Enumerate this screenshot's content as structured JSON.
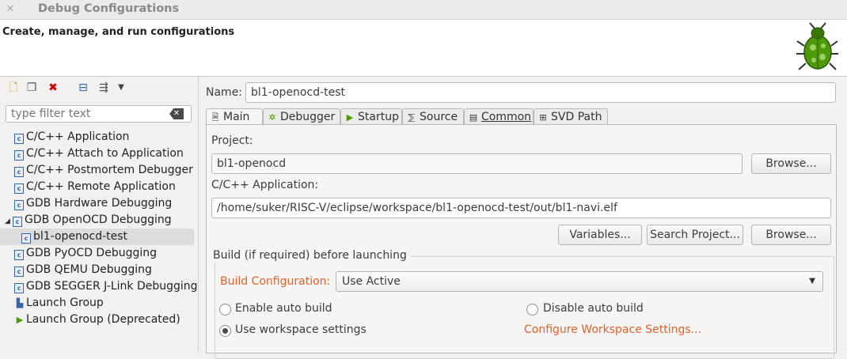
{
  "window": {
    "title": "Debug Configurations"
  },
  "header": {
    "message": "Create, manage, and run configurations"
  },
  "toolbar": {
    "icons": [
      "new-config-icon",
      "duplicate-icon",
      "delete-icon",
      "collapse-all-icon",
      "filter-icon",
      "view-menu-icon"
    ]
  },
  "filter": {
    "placeholder": "type filter text"
  },
  "tree": {
    "items": [
      {
        "label": "C/C++ Application",
        "level": 0
      },
      {
        "label": "C/C++ Attach to Application",
        "level": 0
      },
      {
        "label": "C/C++ Postmortem Debugger",
        "level": 0
      },
      {
        "label": "C/C++ Remote Application",
        "level": 0
      },
      {
        "label": "GDB Hardware Debugging",
        "level": 0
      },
      {
        "label": "GDB OpenOCD Debugging",
        "level": 0,
        "expanded": true
      },
      {
        "label": "bl1-openocd-test",
        "level": 1,
        "selected": true
      },
      {
        "label": "GDB PyOCD Debugging",
        "level": 0
      },
      {
        "label": "GDB QEMU Debugging",
        "level": 0
      },
      {
        "label": "GDB SEGGER J-Link Debugging",
        "level": 0
      },
      {
        "label": "Launch Group",
        "level": 0
      },
      {
        "label": "Launch Group (Deprecated)",
        "level": 0
      }
    ]
  },
  "config": {
    "name_label": "Name:",
    "name_value": "bl1-openocd-test"
  },
  "tabs": [
    {
      "label": "Main",
      "active": true
    },
    {
      "label": "Debugger"
    },
    {
      "label": "Startup"
    },
    {
      "label": "Source"
    },
    {
      "label": "Common"
    },
    {
      "label": "SVD Path"
    }
  ],
  "main": {
    "project_label": "Project:",
    "project_value": "bl1-openocd",
    "browse_label": "Browse...",
    "app_label": "C/C++ Application:",
    "app_value": "/home/suker/RISC-V/eclipse/workspace/bl1-openocd-test/out/bl1-navi.elf",
    "variables_label": "Variables...",
    "search_project_label": "Search Project...",
    "browse2_label": "Browse...",
    "build_group_title": "Build (if required) before launching",
    "build_config_label": "Build Configuration:",
    "build_config_value": "Use Active",
    "enable_auto_build": "Enable auto build",
    "disable_auto_build": "Disable auto build",
    "use_workspace": "Use workspace settings",
    "configure_workspace": "Configure Workspace Settings..."
  },
  "colors": {
    "accent_link": "#e2602b",
    "selection": "#dcdcdc"
  }
}
